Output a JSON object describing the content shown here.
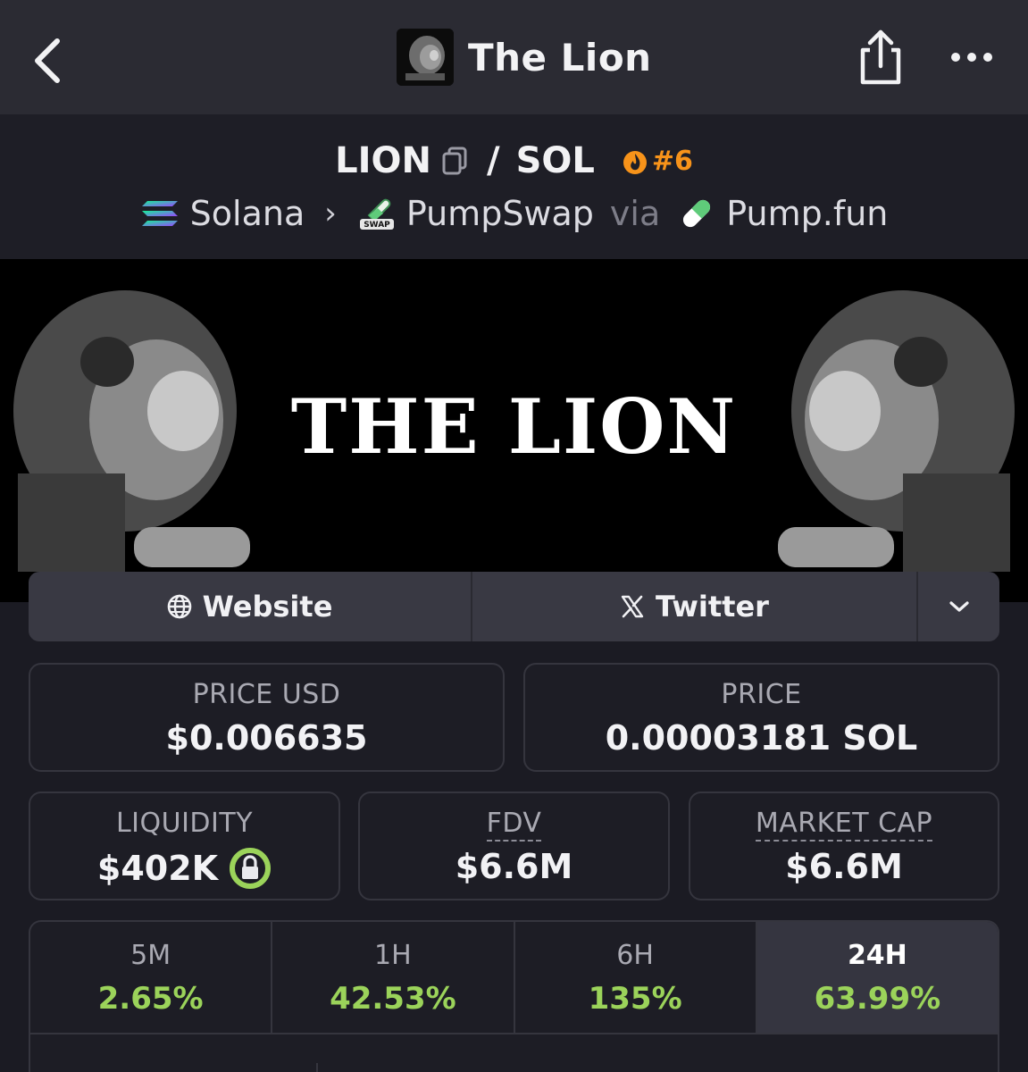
{
  "nav": {
    "title": "The Lion"
  },
  "pair": {
    "base": "LION",
    "separator": "/",
    "quote": "SOL",
    "trending_rank": "#6"
  },
  "breadcrumb": {
    "chain": "Solana",
    "dex": "PumpSwap",
    "via": "via",
    "launchpad": "Pump.fun",
    "dex_icon_text": "SWAP"
  },
  "banner": {
    "text": "THE LION"
  },
  "links": {
    "website": "Website",
    "twitter": "Twitter"
  },
  "stats": {
    "price_usd_label": "PRICE USD",
    "price_usd": "$0.006635",
    "price_label": "PRICE",
    "price_native": "0.00003181 SOL",
    "liquidity_label": "LIQUIDITY",
    "liquidity": "$402K",
    "fdv_label": "FDV",
    "fdv": "$6.6M",
    "mcap_label": "MARKET CAP",
    "mcap": "$6.6M"
  },
  "timeframes": [
    {
      "label": "5M",
      "change": "2.65%"
    },
    {
      "label": "1H",
      "change": "42.53%"
    },
    {
      "label": "6H",
      "change": "135%"
    },
    {
      "label": "24H",
      "change": "63.99%"
    }
  ],
  "colors": {
    "positive": "#9bd35a",
    "trending": "#f7931a",
    "lock_ring": "#9bd35a"
  }
}
